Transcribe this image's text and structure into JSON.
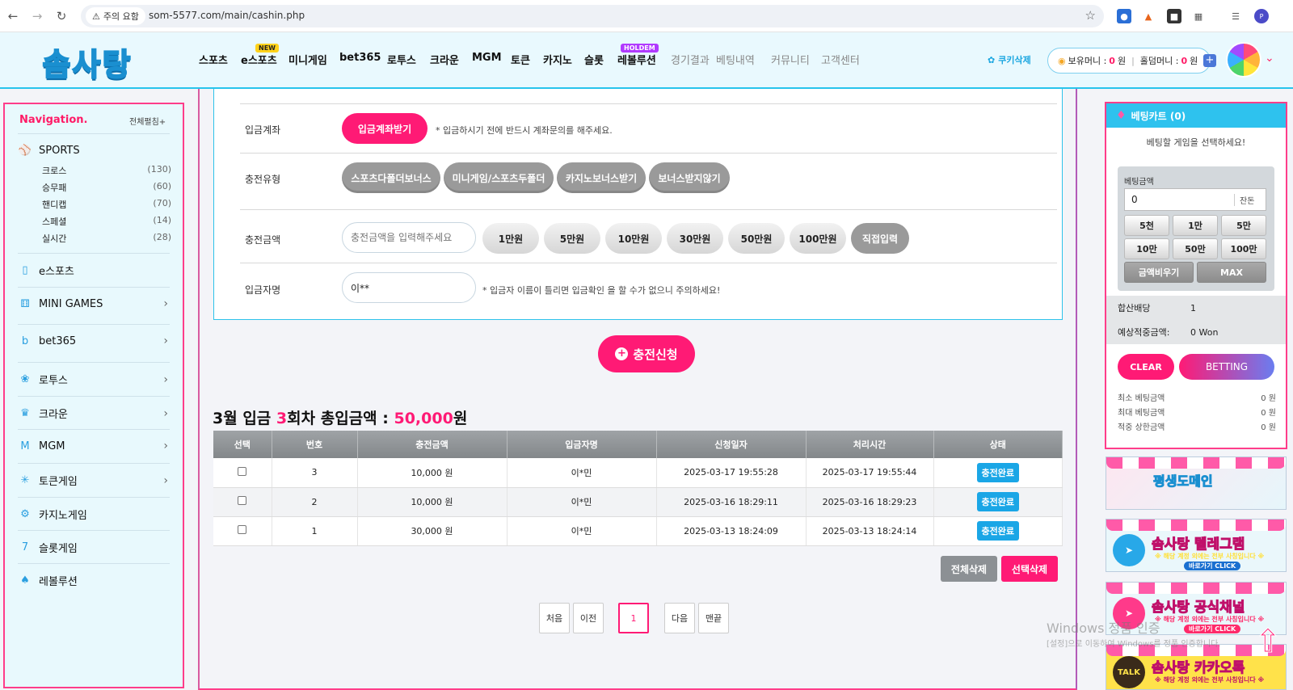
{
  "browser": {
    "security_label": "주의 요함",
    "url": "som-5577.com/main/cashin.php"
  },
  "site": {
    "logo_text": "솜사탕",
    "menu": [
      {
        "label": "스포츠",
        "badge": ""
      },
      {
        "label": "e스포츠",
        "badge": "NEW"
      },
      {
        "label": "미니게임",
        "badge": ""
      },
      {
        "label": "bet365",
        "badge": ""
      },
      {
        "label": "로투스",
        "badge": ""
      },
      {
        "label": "크라운",
        "badge": ""
      },
      {
        "label": "MGM",
        "badge": ""
      },
      {
        "label": "토큰",
        "badge": ""
      },
      {
        "label": "카지노",
        "badge": ""
      },
      {
        "label": "슬롯",
        "badge": ""
      },
      {
        "label": "레볼루션",
        "badge": "HOLDEM"
      },
      {
        "label": "경기결과",
        "badge": ""
      },
      {
        "label": "베팅내역",
        "badge": ""
      },
      {
        "label": "커뮤니티",
        "badge": ""
      },
      {
        "label": "고객센터",
        "badge": ""
      }
    ],
    "cookie_delete": "쿠키삭제",
    "balance_label": "보유머니 :",
    "balance_value": "0",
    "balance_unit": "원",
    "holdem_label": "홀덤머니 :",
    "holdem_value": "0",
    "holdem_unit": "원"
  },
  "nav": {
    "title": "Navigation.",
    "expand_all": "전체펼침+",
    "sports_label": "SPORTS",
    "sports_sub": [
      {
        "label": "크로스",
        "count": "(130)"
      },
      {
        "label": "승무패",
        "count": "(60)"
      },
      {
        "label": "핸디캡",
        "count": "(70)"
      },
      {
        "label": "스페셜",
        "count": "(14)"
      },
      {
        "label": "실시간",
        "count": "(28)"
      }
    ],
    "items": [
      {
        "label": "e스포츠",
        "icon": "mouse-icon",
        "chevron": false
      },
      {
        "label": "MINI GAMES",
        "icon": "dice-icon",
        "chevron": true
      },
      {
        "label": "bet365",
        "icon": "bet365-icon",
        "chevron": true
      },
      {
        "label": "로투스",
        "icon": "lotus-icon",
        "chevron": true
      },
      {
        "label": "크라운",
        "icon": "crown-icon",
        "chevron": true
      },
      {
        "label": "MGM",
        "icon": "mgm-icon",
        "chevron": true
      },
      {
        "label": "토큰게임",
        "icon": "token-icon",
        "chevron": true
      },
      {
        "label": "카지노게임",
        "icon": "casino-chip-icon",
        "chevron": false
      },
      {
        "label": "슬롯게임",
        "icon": "slot-777-icon",
        "chevron": false
      },
      {
        "label": "레볼루션",
        "icon": "cards-icon",
        "chevron": false
      }
    ]
  },
  "deposit_form": {
    "account_label": "입금계좌",
    "account_button": "입금계좌받기",
    "account_note": "* 입금하시기 전에 반드시 계좌문의를 해주세요.",
    "type_label": "충전유형",
    "type_options": [
      "스포츠다폴더보너스",
      "미니게임/스포츠두폴더",
      "카지노보너스받기",
      "보너스받지않기"
    ],
    "amount_label": "충전금액",
    "amount_placeholder": "충전금액을 입력해주세요",
    "amount_options": [
      "1만원",
      "5만원",
      "10만원",
      "30만원",
      "50만원",
      "100만원"
    ],
    "direct_input": "직접입력",
    "depositor_label": "입금자명",
    "depositor_value": "이**",
    "depositor_note": "* 입금자 이름이 틀리면 입금확인 을 할 수가 없으니 주의하세요!",
    "submit": "충전신청"
  },
  "summary": {
    "prefix": "3월 입금",
    "count": "3",
    "middle": "회차 총입금액 :",
    "amount": "50,000",
    "suffix": "원"
  },
  "history": {
    "columns": [
      "선택",
      "번호",
      "충전금액",
      "입금자명",
      "신청일자",
      "처리시간",
      "상태"
    ],
    "rows": [
      {
        "no": "3",
        "amount": "10,000 원",
        "name": "이*민",
        "requested": "2025-03-17 19:55:28",
        "processed": "2025-03-17 19:55:44",
        "status": "충전완료"
      },
      {
        "no": "2",
        "amount": "10,000 원",
        "name": "이*민",
        "requested": "2025-03-16 18:29:11",
        "processed": "2025-03-16 18:29:23",
        "status": "충전완료"
      },
      {
        "no": "1",
        "amount": "30,000 원",
        "name": "이*민",
        "requested": "2025-03-13 18:24:09",
        "processed": "2025-03-13 18:24:14",
        "status": "충전완료"
      }
    ],
    "delete_all": "전체삭제",
    "delete_selected": "선택삭제"
  },
  "pagination": {
    "first": "처음",
    "prev": "이전",
    "current": "1",
    "next": "다음",
    "last": "맨끝"
  },
  "cart": {
    "title": "베팅카트 (0)",
    "empty_msg": "베팅할 게임을 선택하세요!",
    "bet_amount_label": "베팅금액",
    "bet_amount_value": "0",
    "balance_button": "잔돈",
    "quick": [
      "5천",
      "1만",
      "5만",
      "10만",
      "50만",
      "100만"
    ],
    "clear_amount": "금액비우기",
    "max": "MAX",
    "odds_label": "합산배당",
    "odds_value": "1",
    "expected_label": "예상적중금액:",
    "expected_value": "0 Won",
    "clear": "CLEAR",
    "betting": "BETTING",
    "min_label": "최소 베팅금액",
    "min_value": "0 원",
    "max_label": "최대 베팅금액",
    "max_value": "0 원",
    "limit_label": "적중 상한금액",
    "limit_value": "0 원"
  },
  "banners": [
    {
      "title": "평생도메인",
      "sub": "",
      "cta": ""
    },
    {
      "title": "솜사탕 텔레그램",
      "sub": "※ 해당 계정 외에는 전부 사칭입니다 ※",
      "cta": "바로가기 CLICK"
    },
    {
      "title": "솜사탕 공식채널",
      "sub": "※ 해당 계정 외에는 전부 사칭입니다 ※",
      "cta": "바로가기 CLICK"
    },
    {
      "title": "솜사탕 카카오톡",
      "sub": "※ 해당 계정 외에는 전부 사칭입니다 ※",
      "cta": ""
    }
  ],
  "overlay": {
    "watermark": "Windows 정품 인증",
    "watermark_sub": "[설정]으로 이동하여 Windows를 정품 인증합니다."
  }
}
